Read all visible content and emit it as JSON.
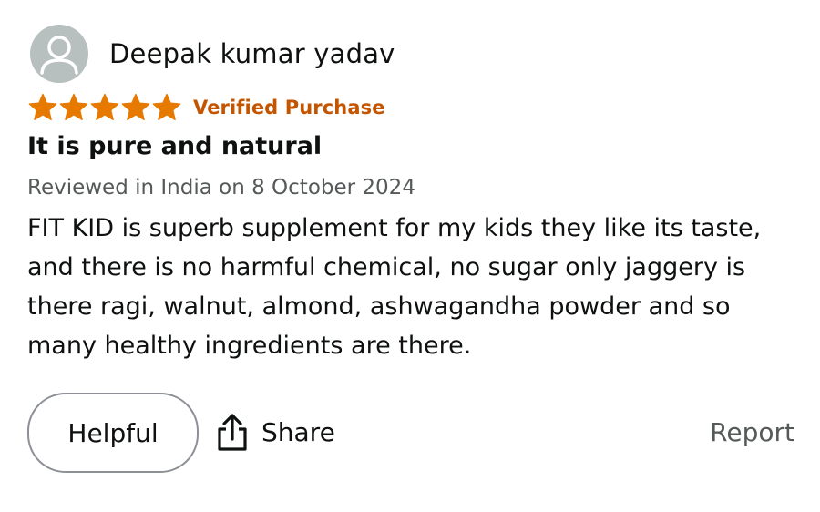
{
  "reviewer": {
    "name": "Deepak kumar yadav",
    "avatar_icon": "user-avatar-icon"
  },
  "rating": {
    "stars": 5,
    "max_stars": 5,
    "star_color": "#e67a00",
    "verified_label": "Verified Purchase",
    "verified_color": "#c45500"
  },
  "review": {
    "title": "It is pure and natural",
    "meta": "Reviewed in India on 8 October 2024",
    "body": "FIT KID is superb supplement for my kids they like its taste, and there is no harmful chemical, no sugar only jaggery is there ragi, walnut, almond, ashwagandha powder and so many healthy ingredients are there."
  },
  "actions": {
    "helpful_label": "Helpful",
    "share_label": "Share",
    "share_icon": "share-icon",
    "report_label": "Report"
  }
}
